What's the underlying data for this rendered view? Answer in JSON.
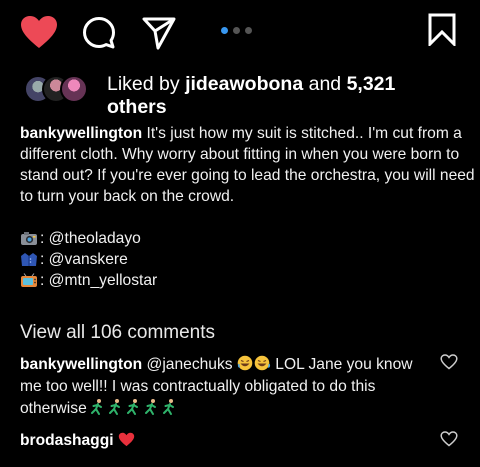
{
  "actions": {
    "like_icon": "heart-filled-icon",
    "comment_icon": "comment-icon",
    "share_icon": "paper-plane-icon",
    "save_icon": "bookmark-icon",
    "like_color": "#ed4956",
    "carousel": {
      "count": 3,
      "active": 1,
      "active_color": "#3897f0"
    }
  },
  "likes": {
    "prefix": "Liked by",
    "user": "jideawobona",
    "and": "and",
    "count": "5,321",
    "suffix": "others"
  },
  "caption": {
    "user": "bankywellington",
    "text": "It's just how my suit is stitched.. I'm cut from a different cloth. Why worry about fitting in when you were born to stand out? If you're ever going to lead the orchestra, you will need to turn your back on the crowd.",
    "credits": [
      {
        "icon": "camera-emoji",
        "text": ": @theoladayo"
      },
      {
        "icon": "coat-emoji",
        "text": ": @vanskere"
      },
      {
        "icon": "tv-emoji",
        "text": ": @mtn_yellostar"
      }
    ]
  },
  "view_all": "View all 106 comments",
  "comments": [
    {
      "user": "bankywellington",
      "text_before": "@janechuks",
      "text_after": "LOL Jane you know me too well!! I was contractually obligated to do this otherwise",
      "icon": "heart-outline-icon"
    },
    {
      "user": "brodashaggi",
      "text_after": "",
      "icon": "heart-outline-icon"
    }
  ]
}
